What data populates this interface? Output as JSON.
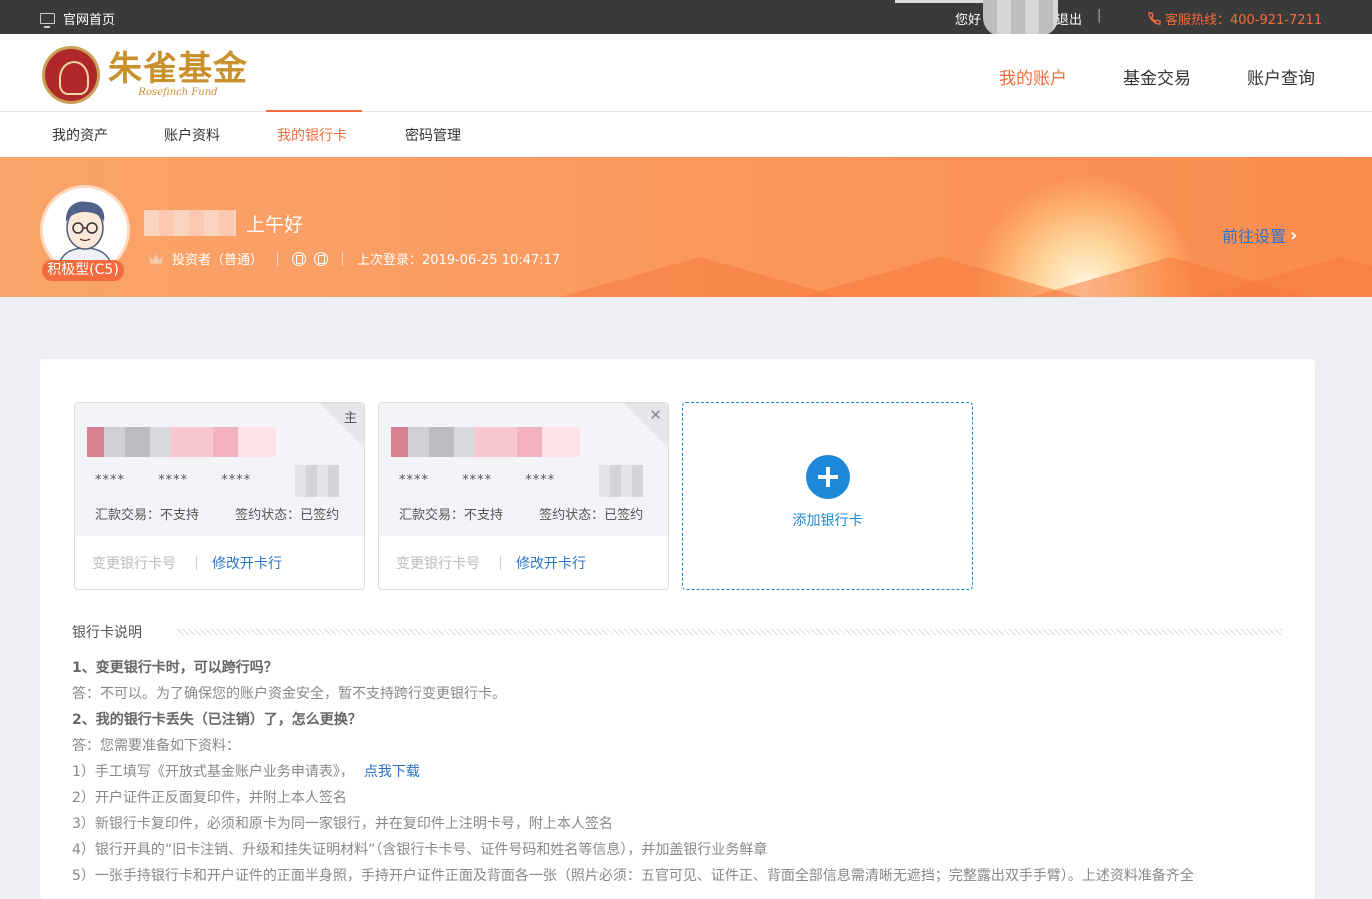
{
  "topbar": {
    "home_label": "官网首页",
    "greet": "您好",
    "logout": "退出",
    "sep": "|",
    "hotline": "客服热线：400-921-7211"
  },
  "logo": {
    "cn": "朱雀基金",
    "en": "Rosefinch Fund"
  },
  "mainnav": [
    "我的账户",
    "基金交易",
    "账户查询"
  ],
  "subnav": [
    "我的资产",
    "账户资料",
    "我的银行卡",
    "密码管理"
  ],
  "banner": {
    "greeting": "上午好",
    "risk": "积极型(C5)",
    "investor": "投资者（普通）",
    "last_login": "上次登录：2019-06-25 10:47:17",
    "settings": "前往设置"
  },
  "cards": [
    {
      "corner": "主",
      "stars": [
        "****",
        "****",
        "****"
      ],
      "remit": "汇款交易：不支持",
      "status": "签约状态：已签约",
      "change": "变更银行卡号",
      "modify": "修改开卡行"
    },
    {
      "corner": "✕",
      "stars": [
        "****",
        "****",
        "****"
      ],
      "remit": "汇款交易：不支持",
      "status": "签约状态：已签约",
      "change": "变更银行卡号",
      "modify": "修改开卡行"
    }
  ],
  "add_card": "添加银行卡",
  "explain": {
    "title": "银行卡说明",
    "q1": "1、变更银行卡时，可以跨行吗？",
    "a1": "答：不可以。为了确保您的账户资金安全，暂不支持跨行变更银行卡。",
    "q2": "2、我的银行卡丢失（已注销）了，怎么更换？",
    "a2": "答：您需要准备如下资料：",
    "l1": "1）手工填写《开放式基金账户业务申请表》，",
    "l1_link": "点我下载",
    "l2": "2）开户证件正反面复印件，并附上本人签名",
    "l3": "3）新银行卡复印件，必须和原卡为同一家银行，并在复印件上注明卡号，附上本人签名",
    "l4": "4）银行开具的“旧卡注销、升级和挂失证明材料”（含银行卡卡号、证件号码和姓名等信息），并加盖银行业务鲜章",
    "l5": "5）一张手持银行卡和开户证件的正面半身照，手持开户证件正面及背面各一张（照片必须：五官可见、证件正、背面全部信息需清晰无遮挡；完整露出双手手臂）。上述资料准备齐全"
  }
}
